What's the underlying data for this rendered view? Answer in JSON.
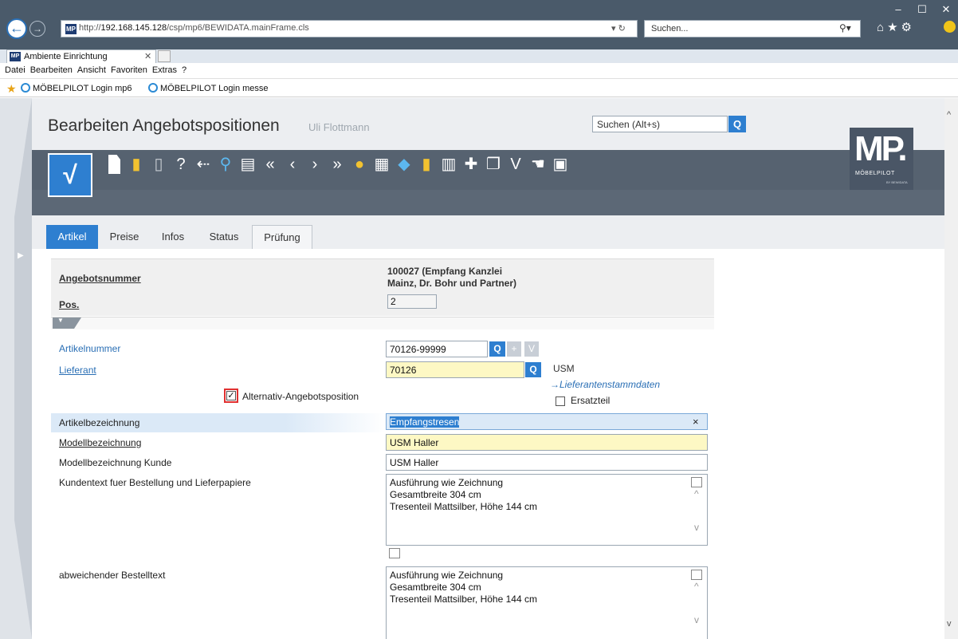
{
  "browser": {
    "url_prefix": "http://",
    "url_host": "192.168.145.128",
    "url_path": "/csp/mp6/BEWIDATA.mainFrame.cls",
    "search_placeholder": "Suchen...",
    "tab_title": "Ambiente Einrichtung",
    "fav_icon_label": "MP",
    "menu": [
      "Datei",
      "Bearbeiten",
      "Ansicht",
      "Favoriten",
      "Extras",
      "?"
    ],
    "favorites": [
      "MÖBELPILOT Login mp6",
      "MÖBELPILOT Login messe"
    ]
  },
  "app": {
    "title": "Bearbeiten Angebotspositionen",
    "user": "Uli Flottmann",
    "search_placeholder": "Suchen (Alt+s)",
    "logo": {
      "big": "MP.",
      "small": "MÖBELPILOT",
      "tiny": "BY BEWIDATA"
    },
    "tabs": [
      "Artikel",
      "Preise",
      "Infos",
      "Status",
      "Prüfung"
    ],
    "active_tab": "Artikel"
  },
  "form": {
    "angebotsnummer_label": "Angebotsnummer",
    "angebotsnummer_value_line1": "100027 (Empfang Kanzlei",
    "angebotsnummer_value_line2": "Mainz, Dr. Bohr und Partner)",
    "pos_label": "Pos.",
    "pos_value": "2",
    "artikelnummer_label": "Artikelnummer",
    "artikelnummer_value": "70126-99999",
    "lieferant_label": "Lieferant",
    "lieferant_value": "70126",
    "lieferant_name": "USM",
    "lieferant_link": "→Lieferantenstammdaten",
    "alternativ_label": "Alternativ-Angebotsposition",
    "alternativ_checked": true,
    "ersatzteil_label": "Ersatzteil",
    "ersatzteil_checked": false,
    "artikelbezeichnung_label": "Artikelbezeichnung",
    "artikelbezeichnung_value": "Empfangstresen",
    "modellbezeichnung_label": "Modellbezeichnung",
    "modellbezeichnung_value": "USM Haller",
    "modellbezeichnung_kunde_label": "Modellbezeichnung Kunde",
    "modellbezeichnung_kunde_value": "USM Haller",
    "kundentext_label": "Kundentext fuer Bestellung und Lieferpapiere",
    "kundentext_lines": [
      "Ausführung wie Zeichnung",
      "Gesamtbreite 304 cm",
      "Tresenteil Mattsilber, Höhe 144 cm"
    ],
    "bestelltext_label": "abweichender Bestelltext",
    "bestelltext_lines": [
      "Ausführung wie Zeichnung",
      "Gesamtbreite 304 cm",
      "Tresenteil Mattsilber, Höhe 144 cm"
    ]
  },
  "colors": {
    "accent": "#2e7fd0",
    "toolbar": "#566270",
    "highlight": "#e03030",
    "required_bg": "#fdf8c4"
  }
}
